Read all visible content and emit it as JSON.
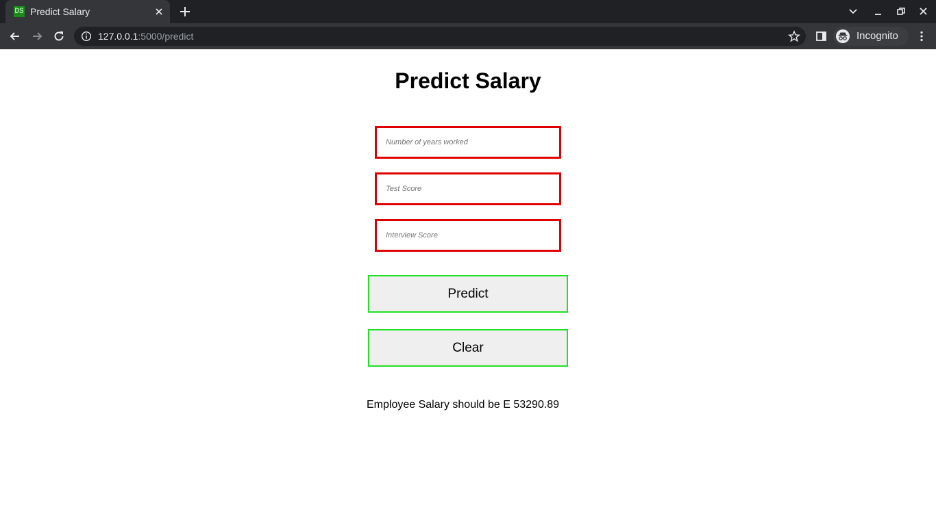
{
  "browser": {
    "tab": {
      "favicon_text": "DS",
      "title": "Predict Salary"
    },
    "url": {
      "host": "127.0.0.1",
      "path": ":5000/predict"
    },
    "profile_label": "Incognito"
  },
  "page": {
    "heading": "Predict Salary",
    "fields": {
      "years_placeholder": "Number of years worked",
      "test_score_placeholder": "Test Score",
      "interview_score_placeholder": "Interview Score"
    },
    "buttons": {
      "predict_label": "Predict",
      "clear_label": "Clear"
    },
    "result_text": "Employee Salary should be E 53290.89"
  },
  "colors": {
    "field_border": "#e00000",
    "button_border": "#22e022",
    "button_background": "#efefef",
    "chrome_dark": "#202124",
    "chrome_toolbar": "#35363a"
  }
}
